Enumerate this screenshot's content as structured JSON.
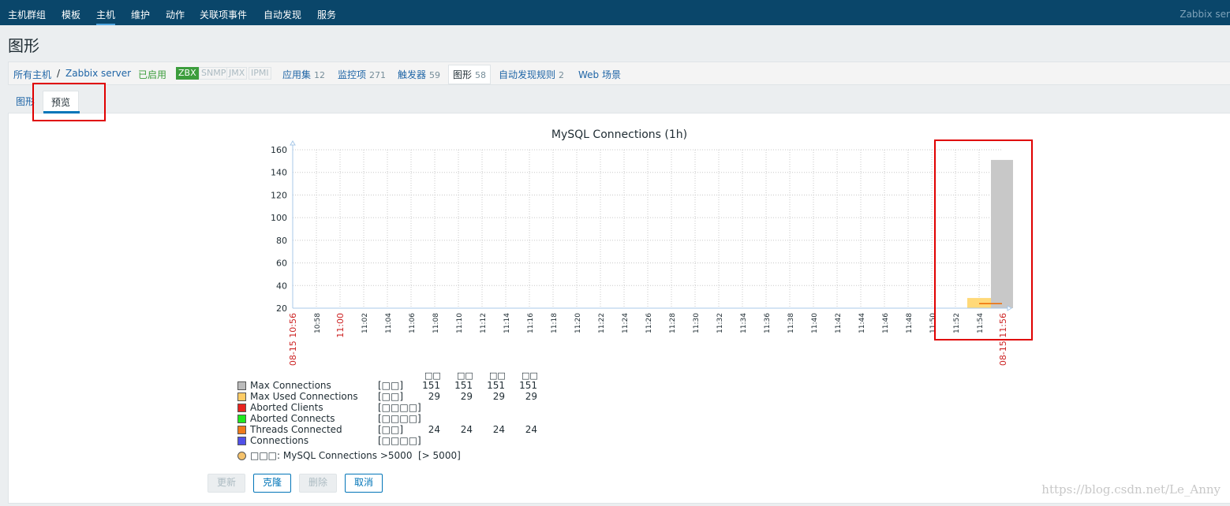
{
  "topnav": {
    "items": [
      "主机群组",
      "模板",
      "主机",
      "维护",
      "动作",
      "关联项事件",
      "自动发现",
      "服务"
    ],
    "brand": "Zabbix ser"
  },
  "page_title": "图形",
  "hostbar": {
    "all_hosts": "所有主机",
    "separator": "/",
    "host": "Zabbix server",
    "status": "已启用",
    "badges": [
      "ZBX",
      "SNMP",
      "JMX",
      "IPMI"
    ],
    "links": [
      {
        "label": "应用集",
        "count": "12"
      },
      {
        "label": "监控项",
        "count": "271"
      },
      {
        "label": "触发器",
        "count": "59"
      },
      {
        "label": "图形",
        "count": "58"
      },
      {
        "label": "自动发现规则",
        "count": "2"
      },
      {
        "label": "Web 场景",
        "count": ""
      }
    ]
  },
  "tabs": [
    "图形",
    "预览"
  ],
  "chart_data": {
    "type": "bar",
    "title": "MySQL Connections (1h)",
    "xlabel": "",
    "ylabel": "",
    "ylim": [
      20,
      160
    ],
    "y_ticks": [
      20,
      40,
      60,
      80,
      100,
      120,
      140,
      160
    ],
    "x_ticks": [
      "08-15 10:56",
      "10:58",
      "11:00",
      "11:02",
      "11:04",
      "11:06",
      "11:08",
      "11:10",
      "11:12",
      "11:14",
      "11:16",
      "11:18",
      "11:20",
      "11:22",
      "11:24",
      "11:26",
      "11:28",
      "11:30",
      "11:32",
      "11:34",
      "11:36",
      "11:38",
      "11:40",
      "11:42",
      "11:44",
      "11:46",
      "11:48",
      "11:50",
      "11:52",
      "11:54",
      "08-15 11:56"
    ],
    "grid": true,
    "series": [
      {
        "name": "Max Connections",
        "color": "#c8c8c8",
        "x": [
          "11:55"
        ],
        "values": [
          151
        ]
      },
      {
        "name": "Max Used Connections",
        "color": "#ffd979",
        "x": [
          "11:53",
          "11:55"
        ],
        "values": [
          29,
          29
        ]
      },
      {
        "name": "Threads Connected",
        "color": "#ef6b00",
        "x": [
          "11:54",
          "11:56"
        ],
        "values": [
          24,
          24
        ]
      }
    ],
    "legend": {
      "headers": [
        "□□",
        "□□",
        "□□",
        "□□"
      ],
      "rows": [
        {
          "name": "Max Connections",
          "fn": "[□□]",
          "color": "#bbbbbb",
          "values": [
            "151",
            "151",
            "151",
            "151"
          ]
        },
        {
          "name": "Max Used Connections",
          "fn": "[□□]",
          "color": "#ffcc66",
          "values": [
            "29",
            "29",
            "29",
            "29"
          ]
        },
        {
          "name": "Aborted Clients",
          "fn": "[□□□□]",
          "color": "#e8231f",
          "values": [
            "",
            "",
            "",
            ""
          ]
        },
        {
          "name": "Aborted Connects",
          "fn": "[□□□□]",
          "color": "#1ee81e",
          "values": [
            "",
            "",
            "",
            ""
          ]
        },
        {
          "name": "Threads Connected",
          "fn": "[□□]",
          "color": "#ef7a1a",
          "values": [
            "24",
            "24",
            "24",
            "24"
          ]
        },
        {
          "name": "Connections",
          "fn": "[□□□□]",
          "color": "#5050e8",
          "values": [
            "",
            "",
            "",
            ""
          ]
        }
      ],
      "trigger": {
        "label": "□□□: MySQL Connections >5000",
        "value": "[> 5000]",
        "color": "#f5c26b"
      }
    }
  },
  "buttons": {
    "update": "更新",
    "clone": "克隆",
    "delete": "删除",
    "cancel": "取消"
  },
  "watermark": "https://blog.csdn.net/Le_Anny"
}
